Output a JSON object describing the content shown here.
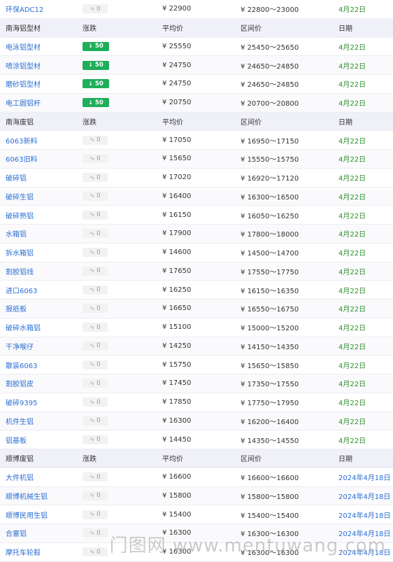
{
  "top_row": {
    "name": "环保ADC12",
    "change": "0",
    "price": "22900",
    "range": "22800～23000",
    "date": "4月22日"
  },
  "sections": [
    {
      "header": {
        "name": "南海铝型材",
        "change": "涨跌",
        "price": "平均价",
        "range": "区间价",
        "date": "日期"
      },
      "rows": [
        {
          "name": "电泳铝型材",
          "change": "50",
          "dir": "down",
          "price": "25550",
          "range": "25450～25650",
          "date": "4月22日"
        },
        {
          "name": "喷涂铝型材",
          "change": "50",
          "dir": "down",
          "price": "24750",
          "range": "24650～24850",
          "date": "4月22日"
        },
        {
          "name": "磨砂铝型材",
          "change": "50",
          "dir": "down",
          "price": "24750",
          "range": "24650～24850",
          "date": "4月22日"
        },
        {
          "name": "电工圆铝杆",
          "change": "50",
          "dir": "down",
          "price": "20750",
          "range": "20700～20800",
          "date": "4月22日"
        }
      ]
    },
    {
      "header": {
        "name": "南海废铝",
        "change": "涨跌",
        "price": "平均价",
        "range": "区间价",
        "date": "日期"
      },
      "rows": [
        {
          "name": "6063新料",
          "change": "0",
          "dir": "flat",
          "price": "17050",
          "range": "16950～17150",
          "date": "4月22日"
        },
        {
          "name": "6063旧料",
          "change": "0",
          "dir": "flat",
          "price": "15650",
          "range": "15550～15750",
          "date": "4月22日"
        },
        {
          "name": "破碎铝",
          "change": "0",
          "dir": "flat",
          "price": "17020",
          "range": "16920～17120",
          "date": "4月22日"
        },
        {
          "name": "破碎生铝",
          "change": "0",
          "dir": "flat",
          "price": "16400",
          "range": "16300～16500",
          "date": "4月22日"
        },
        {
          "name": "破碎熟铝",
          "change": "0",
          "dir": "flat",
          "price": "16150",
          "range": "16050～16250",
          "date": "4月22日"
        },
        {
          "name": "水箱铝",
          "change": "0",
          "dir": "flat",
          "price": "17900",
          "range": "17800～18000",
          "date": "4月22日"
        },
        {
          "name": "拆水箱铝",
          "change": "0",
          "dir": "flat",
          "price": "14600",
          "range": "14500～14700",
          "date": "4月22日"
        },
        {
          "name": "割胶铝线",
          "change": "0",
          "dir": "flat",
          "price": "17650",
          "range": "17550～17750",
          "date": "4月22日"
        },
        {
          "name": "进口6063",
          "change": "0",
          "dir": "flat",
          "price": "16250",
          "range": "16150～16350",
          "date": "4月22日"
        },
        {
          "name": "报纸板",
          "change": "0",
          "dir": "flat",
          "price": "16650",
          "range": "16550～16750",
          "date": "4月22日"
        },
        {
          "name": "破碎水箱铝",
          "change": "0",
          "dir": "flat",
          "price": "15100",
          "range": "15000～15200",
          "date": "4月22日"
        },
        {
          "name": "干净喉仔",
          "change": "0",
          "dir": "flat",
          "price": "14250",
          "range": "14150～14350",
          "date": "4月22日"
        },
        {
          "name": "散装6063",
          "change": "0",
          "dir": "flat",
          "price": "15750",
          "range": "15650～15850",
          "date": "4月22日"
        },
        {
          "name": "割胶铝皮",
          "change": "0",
          "dir": "flat",
          "price": "17450",
          "range": "17350～17550",
          "date": "4月22日"
        },
        {
          "name": "破碎9395",
          "change": "0",
          "dir": "flat",
          "price": "17850",
          "range": "17750～17950",
          "date": "4月22日"
        },
        {
          "name": "机件生铝",
          "change": "0",
          "dir": "flat",
          "price": "16300",
          "range": "16200～16400",
          "date": "4月22日"
        },
        {
          "name": "铝基板",
          "change": "0",
          "dir": "flat",
          "price": "14450",
          "range": "14350～14550",
          "date": "4月22日"
        }
      ]
    },
    {
      "header": {
        "name": "顺博废铝",
        "change": "涨跌",
        "price": "平均价",
        "range": "区间价",
        "date": "日期"
      },
      "rows": [
        {
          "name": "大件机铝",
          "change": "0",
          "dir": "flat",
          "price": "16600",
          "range": "16600～16600",
          "date": "2024年4月18日"
        },
        {
          "name": "顺博机械生铝",
          "change": "0",
          "dir": "flat",
          "price": "15800",
          "range": "15800～15800",
          "date": "2024年4月18日"
        },
        {
          "name": "顺博民用生铝",
          "change": "0",
          "dir": "flat",
          "price": "15400",
          "range": "15400～15400",
          "date": "2024年4月18日"
        },
        {
          "name": "合塞铝",
          "change": "0",
          "dir": "flat",
          "price": "16300",
          "range": "16300～16300",
          "date": "2024年4月18日"
        },
        {
          "name": "摩托车轮毂",
          "change": "0",
          "dir": "flat",
          "price": "16300",
          "range": "16300～16300",
          "date": "2024年4月18日"
        }
      ]
    }
  ],
  "currency_symbol": "¥",
  "watermark": "门图网 www.mentuwang.com",
  "colors": {
    "header_bg": "#f0f0f8",
    "name_blue": "#2b6fd4",
    "date_green": "#2f8f2f",
    "down_badge": "#1fae5b",
    "flat_badge": "#f2f2f2"
  },
  "icons": {
    "flat": "flat-change-icon",
    "down": "down-arrow-icon"
  }
}
